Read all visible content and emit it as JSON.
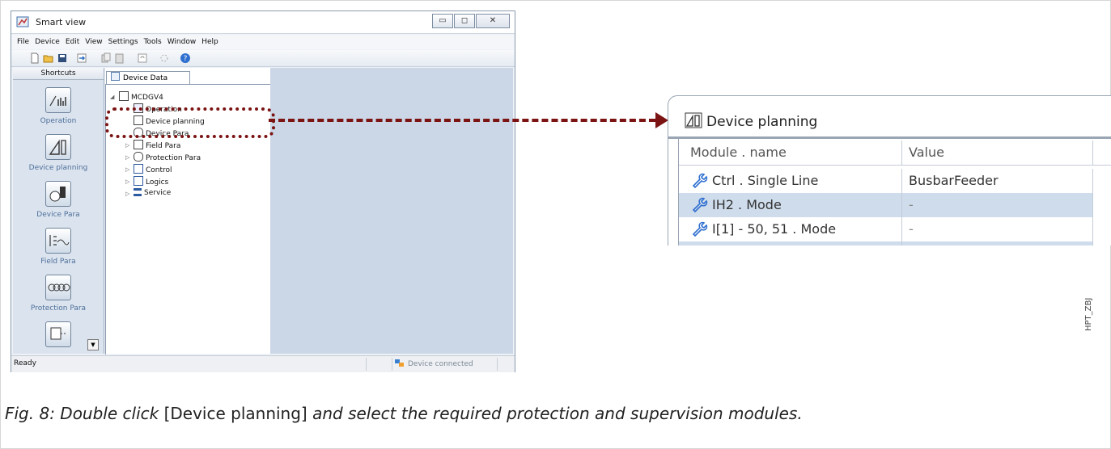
{
  "window": {
    "title": "Smart view",
    "menu": [
      "File",
      "Device",
      "Edit",
      "View",
      "Settings",
      "Tools",
      "Window",
      "Help"
    ],
    "shortcuts_header": "Shortcuts",
    "shortcuts": [
      {
        "label": "Operation"
      },
      {
        "label": "Device planning"
      },
      {
        "label": "Device Para"
      },
      {
        "label": "Field Para"
      },
      {
        "label": "Protection Para"
      }
    ],
    "tab_label": "Device Data",
    "tree": {
      "root": "MCDGV4",
      "children": [
        "Operation",
        "Device planning",
        "Device Para",
        "Field Para",
        "Protection Para",
        "Control",
        "Logics",
        "Service"
      ]
    },
    "status_left": "Ready",
    "status_right": "Device connected"
  },
  "zoom": {
    "title": "Device planning",
    "headers": [
      "Module . name",
      "Value"
    ],
    "rows": [
      {
        "name": "Ctrl . Single Line",
        "value": "BusbarFeeder"
      },
      {
        "name": "IH2 . Mode",
        "value": "-"
      },
      {
        "name": "I[1] - 50, 51 . Mode",
        "value": "-"
      }
    ]
  },
  "side_tag": "HPT_ZBJ",
  "caption": {
    "prefix": "Fig. 8: Double click",
    "bracket": "[Device planning]",
    "suffix": "and select the required protection and supervision modules."
  },
  "colors": {
    "accent": "#7b1313",
    "tree_bg": "#cbd7e6",
    "sidebar_bg": "#dbe4ee"
  }
}
